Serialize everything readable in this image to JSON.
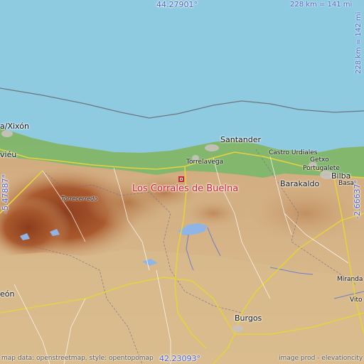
{
  "map": {
    "main_place": "Los Corrales de Buelna",
    "coords": {
      "top": "44.27901°",
      "bottom": "42.23093°",
      "left": "-5.47887°",
      "right": "-2.66637°"
    },
    "scale": {
      "horizontal": "228 km = 141 mi",
      "vertical": "228 km = 142 mi"
    },
    "cities": {
      "santander": "Santander",
      "torrelavega": "Torrelavega",
      "castro_urdiales": "Castro Urdiales",
      "getxo": "Getxo",
      "portugalete": "Portugalete",
      "bilbao": "Bilba",
      "barakaldo": "Barakaldo",
      "basauri": "Basa",
      "gijon": "a/Xixón",
      "oviedo": "viéu",
      "torrecerredo": "Torrecerredo",
      "leon": "eón",
      "burgos": "Burgos",
      "miranda": "Miranda d",
      "vitoria": "Vito"
    },
    "credits": {
      "left": "map data: openstreetmap, style: opentopomap",
      "right": "image prod - elevationcity"
    },
    "colors": {
      "sea": "#8ecbe0",
      "lowland": "#d6b98c",
      "mountain": "#a0562d",
      "forest": "#5cab5a",
      "road_major": "#e3d23f",
      "highlight": "#d2202c",
      "coord_text": "#4c5ec9"
    }
  }
}
